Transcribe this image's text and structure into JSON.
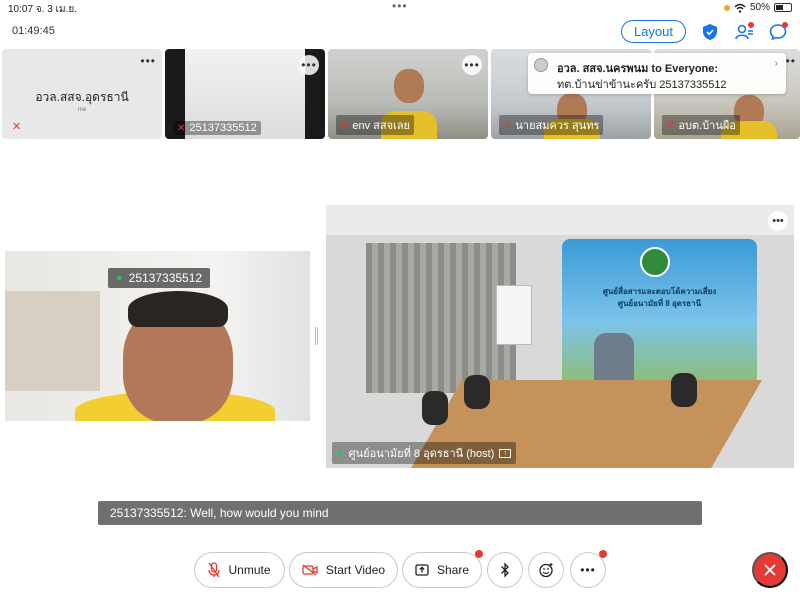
{
  "status_bar": {
    "time_date": "10:07  จ. 3 เม.ย.",
    "center": "•••",
    "battery": "50%"
  },
  "timer": "01:49:45",
  "top_right": {
    "layout_label": "Layout"
  },
  "thumbnails": [
    {
      "name": "อวล.สสจ.อุดรธานี",
      "sub": "me"
    },
    {
      "name": "25137335512"
    },
    {
      "name": "env สสจเลย"
    },
    {
      "name": "นายสมควร สุนทร"
    },
    {
      "name": "อบต.บ้านผือ"
    }
  ],
  "chat_toast": {
    "title": "อวล. สสจ.นครพนม to Everyone:",
    "message": "ทต.บ้านข่าข้านะครับ 25137335512"
  },
  "main_videos": {
    "left_label": "25137335512",
    "right_label": "ศูนย์อนามัยที่ 8 อุดรธานี (host)",
    "banner_line1": "ศูนย์สื่อสารและตอบโต้ความเสี่ยง",
    "banner_line2": "ศูนย์อนามัยที่ 8 อุดรธานี"
  },
  "caption": "25137335512: Well, how would you mind",
  "toolbar": {
    "unmute": "Unmute",
    "start_video": "Start Video",
    "share": "Share"
  },
  "colors": {
    "accent": "#1a73e8",
    "danger": "#e53935",
    "mic_on": "#22c55e"
  }
}
